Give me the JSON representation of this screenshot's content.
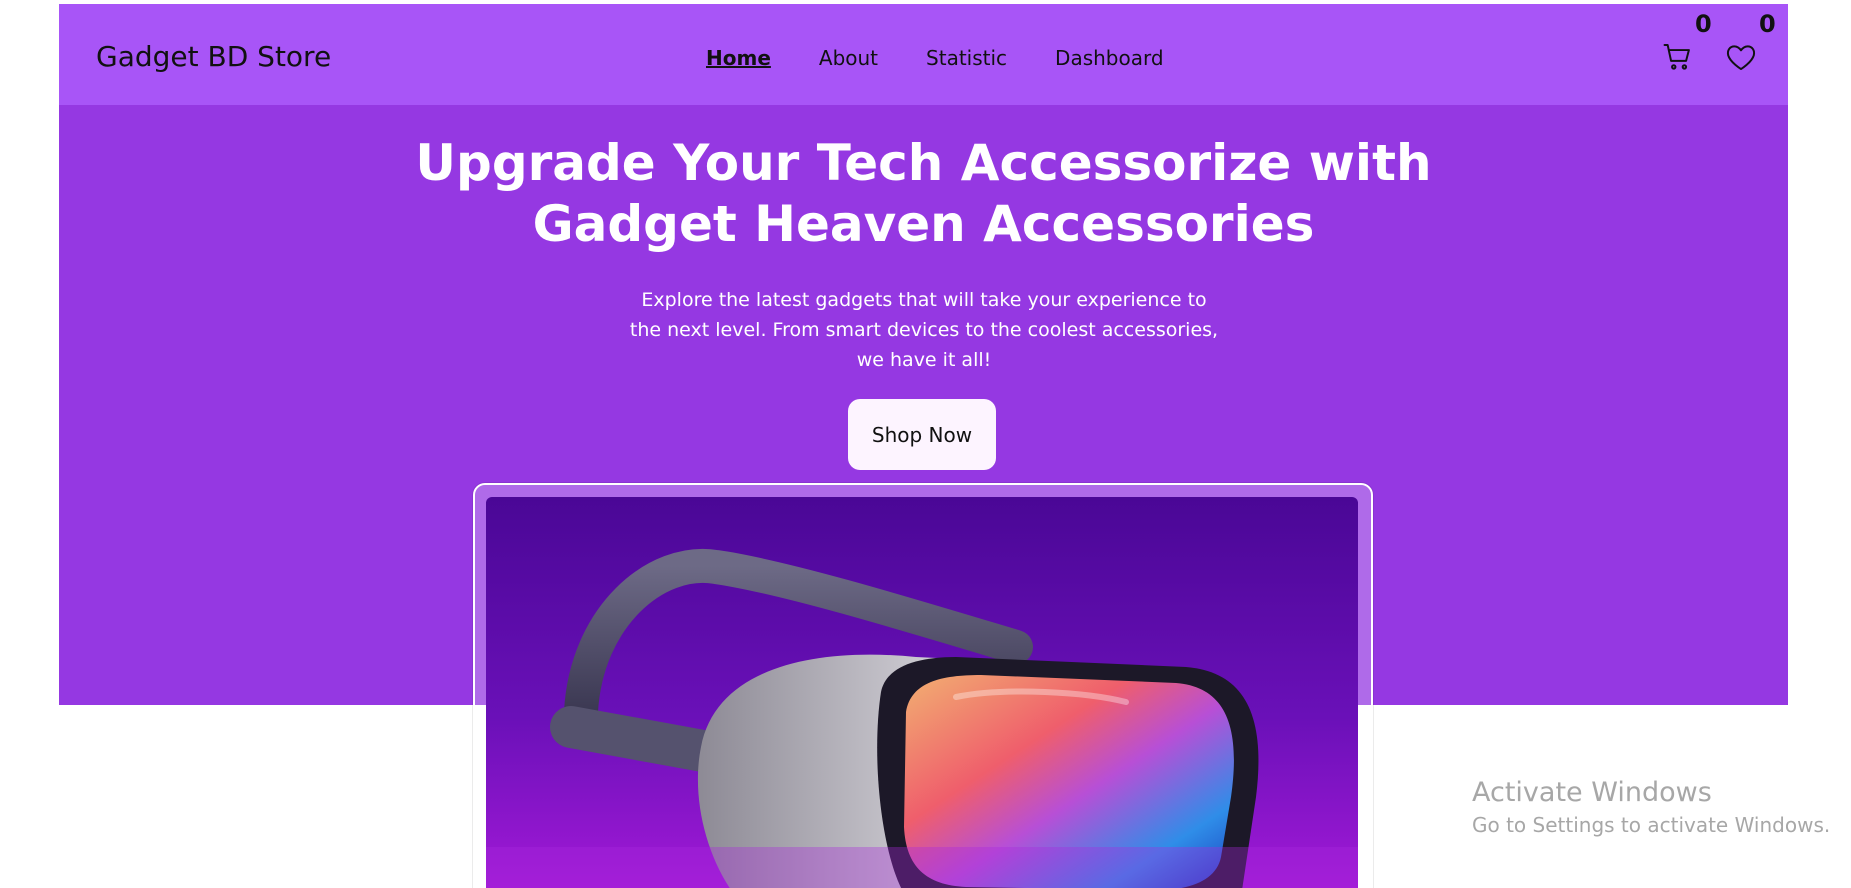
{
  "colors": {
    "navbar_bg": "#a855f7",
    "hero_bg": "#9538e2",
    "button_bg": "#fdf4ff",
    "text_dark": "#111111",
    "text_light": "#ffffff"
  },
  "navbar": {
    "brand": "Gadget BD Store",
    "links": [
      {
        "label": "Home",
        "active": true
      },
      {
        "label": "About",
        "active": false
      },
      {
        "label": "Statistic",
        "active": false
      },
      {
        "label": "Dashboard",
        "active": false
      }
    ],
    "cart": {
      "icon": "cart-icon",
      "count": "0"
    },
    "wishlist": {
      "icon": "heart-icon",
      "count": "0"
    }
  },
  "hero": {
    "title_line1": "Upgrade Your Tech Accessorize with",
    "title_line2": "Gadget Heaven Accessories",
    "subtitle": "Explore the latest gadgets that will take your experience to the next level. From smart devices to the coolest accessories, we have it all!",
    "button_label": "Shop Now"
  },
  "banner": {
    "image": "vr-headset-image"
  },
  "watermark": {
    "title": "Activate Windows",
    "subtitle": "Go to Settings to activate Windows."
  }
}
